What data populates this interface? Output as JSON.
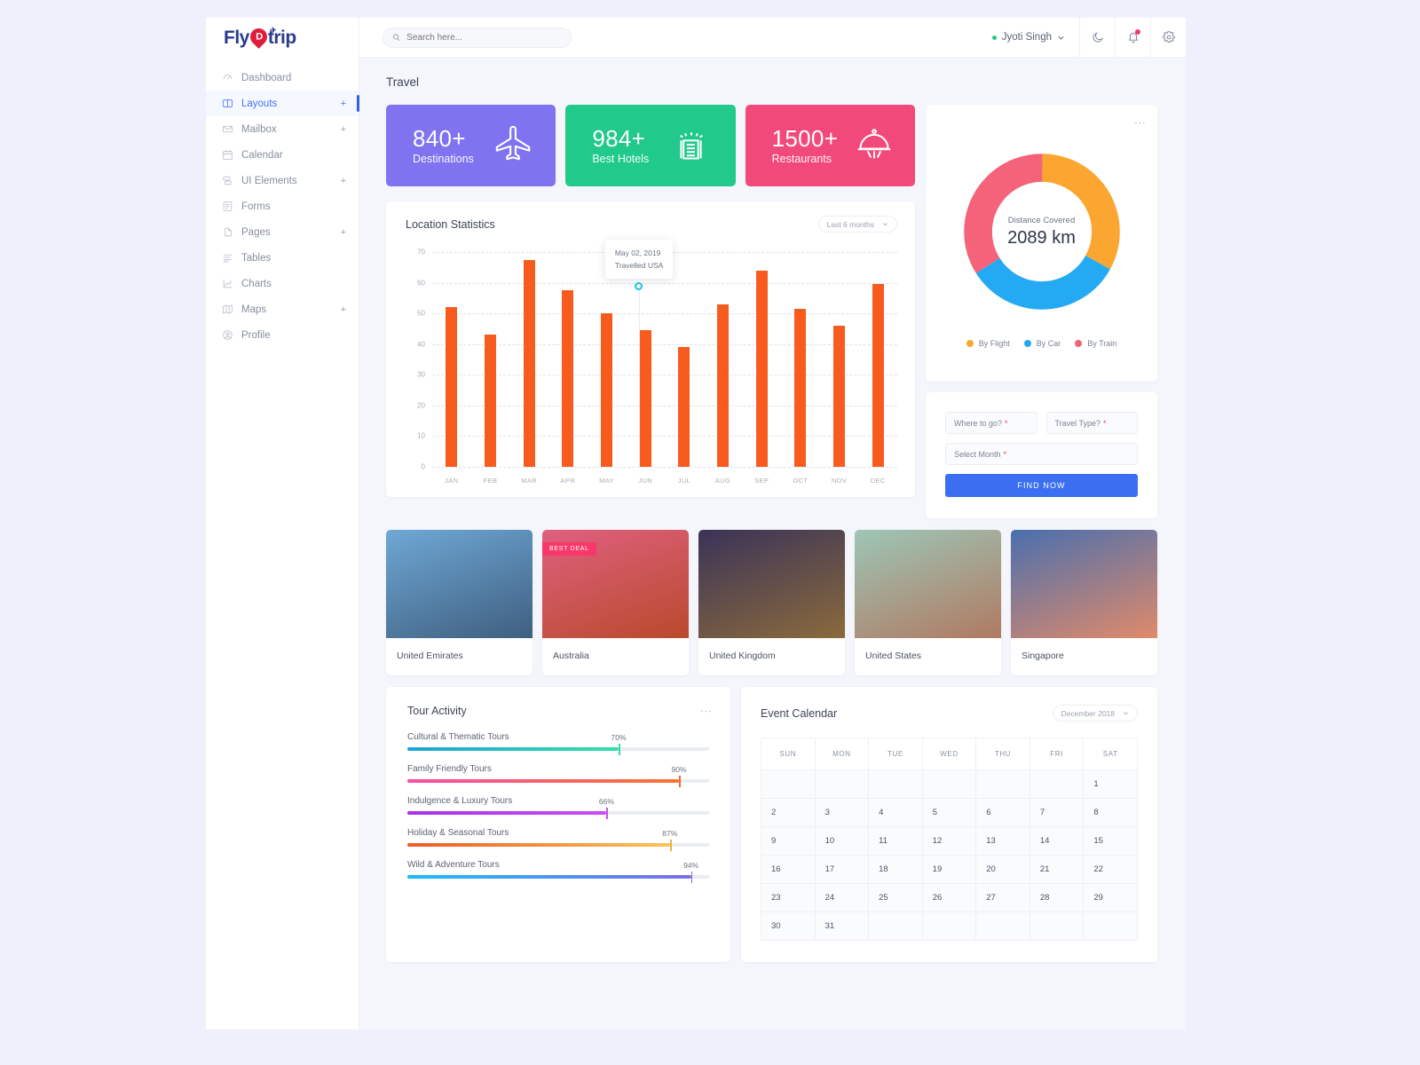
{
  "brand": {
    "text_a": "Fly",
    "pin": "D",
    "text_b": "trip"
  },
  "search": {
    "placeholder": "Search here...",
    "value": "",
    "icon": "search-icon"
  },
  "header": {
    "user": "Jyoti Singh",
    "chevron": "⌄",
    "icons": {
      "moon": "dark-mode-icon",
      "bell": "notifications-icon",
      "gear": "settings-icon"
    }
  },
  "sidebar": {
    "items": [
      {
        "label": "Dashboard",
        "icon": "dashboard-icon",
        "expand": "",
        "active": false
      },
      {
        "label": "Layouts",
        "icon": "layouts-icon",
        "expand": "+",
        "active": true
      },
      {
        "label": "Mailbox",
        "icon": "mailbox-icon",
        "expand": "+",
        "active": false
      },
      {
        "label": "Calendar",
        "icon": "calendar-icon",
        "expand": "",
        "active": false
      },
      {
        "label": "UI Elements",
        "icon": "ui-elements-icon",
        "expand": "+",
        "active": false
      },
      {
        "label": "Forms",
        "icon": "forms-icon",
        "expand": "",
        "active": false
      },
      {
        "label": "Pages",
        "icon": "pages-icon",
        "expand": "+",
        "active": false
      },
      {
        "label": "Tables",
        "icon": "tables-icon",
        "expand": "",
        "active": false
      },
      {
        "label": "Charts",
        "icon": "charts-icon",
        "expand": "",
        "active": false
      },
      {
        "label": "Maps",
        "icon": "maps-icon",
        "expand": "+",
        "active": false
      },
      {
        "label": "Profile",
        "icon": "profile-icon",
        "expand": "",
        "active": false
      }
    ]
  },
  "page": {
    "title": "Travel"
  },
  "stats": [
    {
      "value": "840+",
      "label": "Destinations",
      "color": "#7f73ef",
      "icon": "airplane-icon"
    },
    {
      "value": "984+",
      "label": "Best Hotels",
      "color": "#21c98b",
      "icon": "hotel-icon"
    },
    {
      "value": "1500+",
      "label": "Restaurants",
      "color": "#f2497b",
      "icon": "food-cloche-icon"
    }
  ],
  "chart_data": {
    "type": "bar",
    "title": "Location Statistics",
    "range_label": "Last 6 months",
    "categories": [
      "JAN",
      "FEB",
      "MAR",
      "APR",
      "MAY",
      "JUN",
      "JUL",
      "AUG",
      "SEP",
      "OCT",
      "NOV",
      "DEC"
    ],
    "values": [
      52,
      43,
      67.5,
      57.5,
      50,
      44.5,
      39,
      53,
      64,
      51.5,
      46,
      59.5
    ],
    "yticks": [
      0,
      10,
      20,
      30,
      40,
      50,
      60,
      70
    ],
    "ylim": [
      0,
      70
    ],
    "xlabel": "",
    "ylabel": "",
    "grid": true,
    "legend": "none",
    "bar_color": "#f75c1e",
    "annotation": {
      "date": "May 02, 2019",
      "text": "Travelled USA",
      "at_category": "JUN",
      "at_value": 59
    }
  },
  "donut": {
    "center_label": "Distance Covered",
    "center_value": "2089 km",
    "type": "pie",
    "segments": [
      {
        "name": "By Flight",
        "percent": 33,
        "color": "#fba630"
      },
      {
        "name": "By Car",
        "percent": 33,
        "color": "#23aaf2"
      },
      {
        "name": "By Train",
        "percent": 34,
        "color": "#f4637a"
      }
    ]
  },
  "find_form": {
    "where": "Where to go?",
    "travel_type": "Travel Type?",
    "month": "Select Month",
    "required_mark": "*",
    "button": "FIND NOW"
  },
  "destinations": [
    {
      "name": "United Emirates",
      "badge": "",
      "c1": "#6fa8d6",
      "c2": "#3f5f7f"
    },
    {
      "name": "Australia",
      "badge": "BEST DEAL",
      "c1": "#e0607f",
      "c2": "#b84a2c"
    },
    {
      "name": "United Kingdom",
      "badge": "",
      "c1": "#3b3358",
      "c2": "#8a6a3c"
    },
    {
      "name": "United States",
      "badge": "",
      "c1": "#9dc6b6",
      "c2": "#b07a62"
    },
    {
      "name": "Singapore",
      "badge": "",
      "c1": "#4a6fae",
      "c2": "#e08a6a"
    }
  ],
  "tour_activity": {
    "title": "Tour Activity",
    "items": [
      {
        "label": "Cultural & Thematic Tours",
        "percent": 70,
        "pct_text": "70%",
        "from": "#1ba3d8",
        "to": "#35e0a8",
        "handle": "#35e0a8"
      },
      {
        "label": "Family Friendly Tours",
        "percent": 90,
        "pct_text": "90%",
        "from": "#fb4ea6",
        "to": "#f97432",
        "handle": "#f9632f"
      },
      {
        "label": "Indulgence & Luxury Tours",
        "percent": 66,
        "pct_text": "66%",
        "from": "#a930e8",
        "to": "#cc4df5",
        "handle": "#cc4df5"
      },
      {
        "label": "Holiday & Seasonal Tours",
        "percent": 87,
        "pct_text": "87%",
        "from": "#ee5a24",
        "to": "#f8c45a",
        "handle": "#f0b23d"
      },
      {
        "label": "Wild & Adventure Tours",
        "percent": 94,
        "pct_text": "94%",
        "from": "#19bef5",
        "to": "#7c6fe8",
        "handle": "#7c6fe8"
      }
    ]
  },
  "calendar": {
    "title": "Event Calendar",
    "month_label": "December 2018",
    "weekdays": [
      "SUN",
      "MON",
      "TUE",
      "WED",
      "THU",
      "FRI",
      "SAT"
    ],
    "weeks": [
      [
        "",
        "",
        "",
        "",
        "",
        "",
        "1"
      ],
      [
        "2",
        "3",
        "4",
        "5",
        "6",
        "7",
        "8"
      ],
      [
        "9",
        "10",
        "11",
        "12",
        "13",
        "14",
        "15"
      ],
      [
        "16",
        "17",
        "18",
        "19",
        "20",
        "21",
        "22"
      ],
      [
        "23",
        "24",
        "25",
        "26",
        "27",
        "28",
        "29"
      ],
      [
        "30",
        "31",
        "",
        "",
        "",
        "",
        ""
      ]
    ]
  }
}
